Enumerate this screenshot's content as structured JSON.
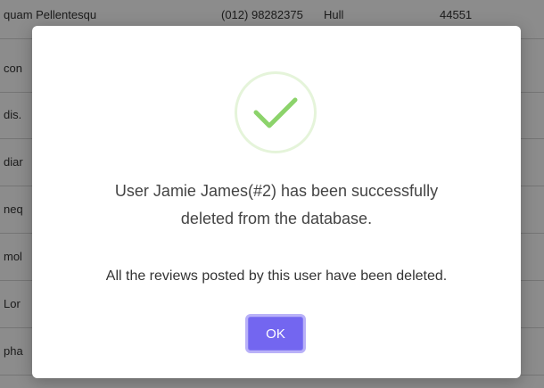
{
  "background_table": {
    "rows": [
      {
        "c1": "quam Pellentesqu",
        "c2": "(012) 98282375",
        "c3": "Hull",
        "c4": "44551"
      },
      {
        "c1": "con",
        "c2": "",
        "c3": "",
        "c4": ""
      },
      {
        "c1": "dis.",
        "c2": "",
        "c3": "",
        "c4": ""
      },
      {
        "c1": "diar",
        "c2": "",
        "c3": "",
        "c4": ""
      },
      {
        "c1": "neq",
        "c2": "",
        "c3": "",
        "c4": ""
      },
      {
        "c1": "mol",
        "c2": "",
        "c3": "",
        "c4": ""
      },
      {
        "c1": "Lor",
        "c2": "",
        "c3": "",
        "c4": ""
      },
      {
        "c1": "pha",
        "c2": "",
        "c3": "",
        "c4": ""
      }
    ]
  },
  "modal": {
    "icon": "check-circle-icon",
    "message_line1": "User Jamie James(#2) has been successfully",
    "message_line2": "deleted from the database.",
    "submessage": "All the reviews posted by this user have been deleted.",
    "ok_label": "OK"
  },
  "colors": {
    "overlay": "#000000",
    "icon_ring": "#e5f4da",
    "checkmark": "#8cd36b",
    "button_bg": "#7366f0",
    "button_border": "#b9b1f8"
  }
}
